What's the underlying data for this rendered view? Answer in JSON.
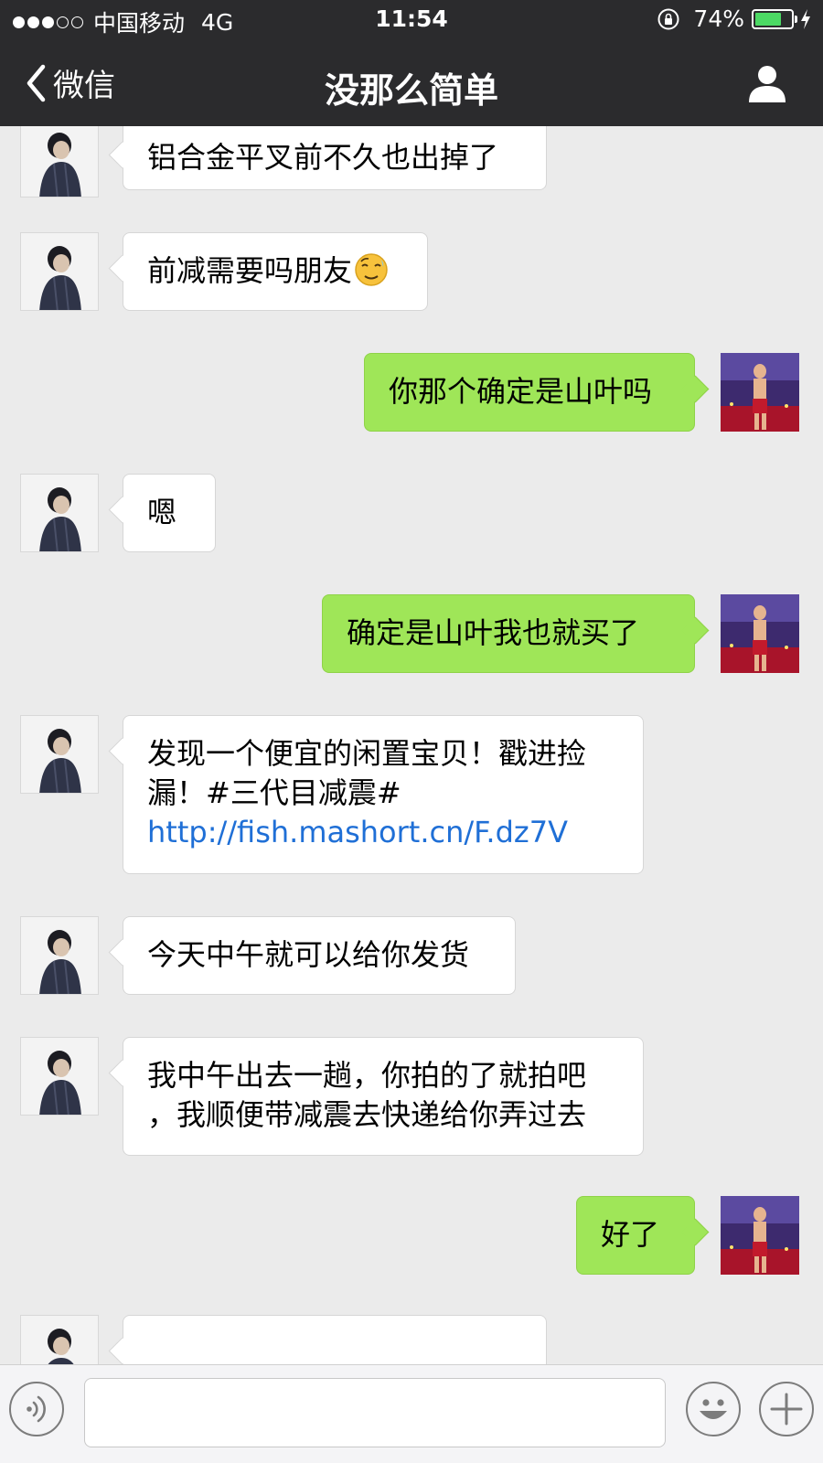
{
  "status_bar": {
    "signal_full": 3,
    "signal_empty": 2,
    "carrier": "中国移动",
    "network": "4G",
    "time": "11:54",
    "battery_percent_label": "74%",
    "battery_level": 0.74,
    "battery_color": "#4cd964"
  },
  "nav": {
    "back_label": "微信",
    "title": "没那么简单",
    "back_icon": "chevron-left-icon",
    "profile_icon": "person-icon"
  },
  "messages": [
    {
      "side": "left",
      "text": "铝合金平叉前不久也出掉了"
    },
    {
      "side": "left",
      "text": "前减需要吗朋友",
      "emoji": "relieved-face-emoji"
    },
    {
      "side": "right",
      "text": "你那个确定是山叶吗"
    },
    {
      "side": "left",
      "text": "嗯"
    },
    {
      "side": "right",
      "text": "确定是山叶我也就买了"
    },
    {
      "side": "left",
      "line1": "发现一个便宜的闲置宝贝！戳进捡",
      "line2": "漏！#三代目减震#",
      "link": "http://fish.mashort.cn/F.dz7V"
    },
    {
      "side": "left",
      "text": "今天中午就可以给你发货"
    },
    {
      "side": "left",
      "line1": "我中午出去一趟，你拍的了就拍吧",
      "line2": "，我顺便带减震去快递给你弄过去"
    },
    {
      "side": "right",
      "text": "好了"
    }
  ],
  "colors": {
    "bar_background": "#2b2b2d",
    "chat_background": "#ebebeb",
    "sent_bubble": "#9fe658",
    "received_bubble": "#ffffff",
    "link": "#1f6fd6"
  },
  "input_bar": {
    "voice_icon": "voice-icon",
    "emoji_icon": "smiley-icon",
    "plus_icon": "plus-icon",
    "text_value": ""
  }
}
